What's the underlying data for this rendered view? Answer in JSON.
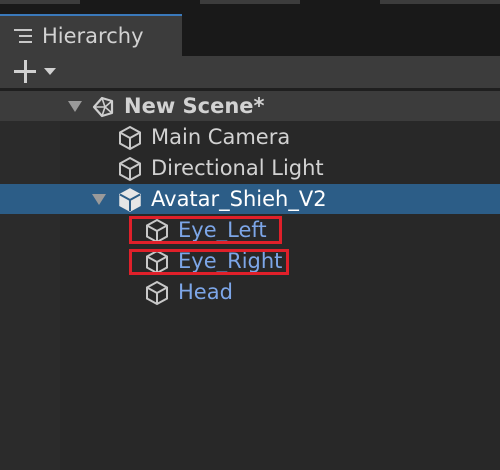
{
  "window": {
    "tab_title": "Hierarchy",
    "tab_icon": "hierarchy-list-icon"
  },
  "toolbar": {
    "create_icon": "plus-icon",
    "dropdown_icon": "caret-down-icon"
  },
  "tree": {
    "scene": {
      "label": "New Scene*",
      "icon": "unity-scene-icon",
      "expanded": true
    },
    "items": [
      {
        "label": "Main Camera",
        "icon": "gameobject-cube-icon",
        "depth": 1
      },
      {
        "label": "Directional Light",
        "icon": "gameobject-cube-icon",
        "depth": 1
      },
      {
        "label": "Avatar_Shieh_V2",
        "icon": "prefab-cube-icon",
        "depth": 1,
        "expanded": true,
        "selected": true
      },
      {
        "label": "Eye_Left",
        "icon": "gameobject-cube-icon",
        "depth": 2,
        "highlighted": true
      },
      {
        "label": "Eye_Right",
        "icon": "gameobject-cube-icon",
        "depth": 2,
        "highlighted": true
      },
      {
        "label": "Head",
        "icon": "gameobject-cube-icon",
        "depth": 2
      }
    ]
  },
  "colors": {
    "selection": "#2c5d87",
    "child_text": "#7da6e8",
    "highlight_box": "#e0202a",
    "tab_accent": "#3a79bb"
  }
}
